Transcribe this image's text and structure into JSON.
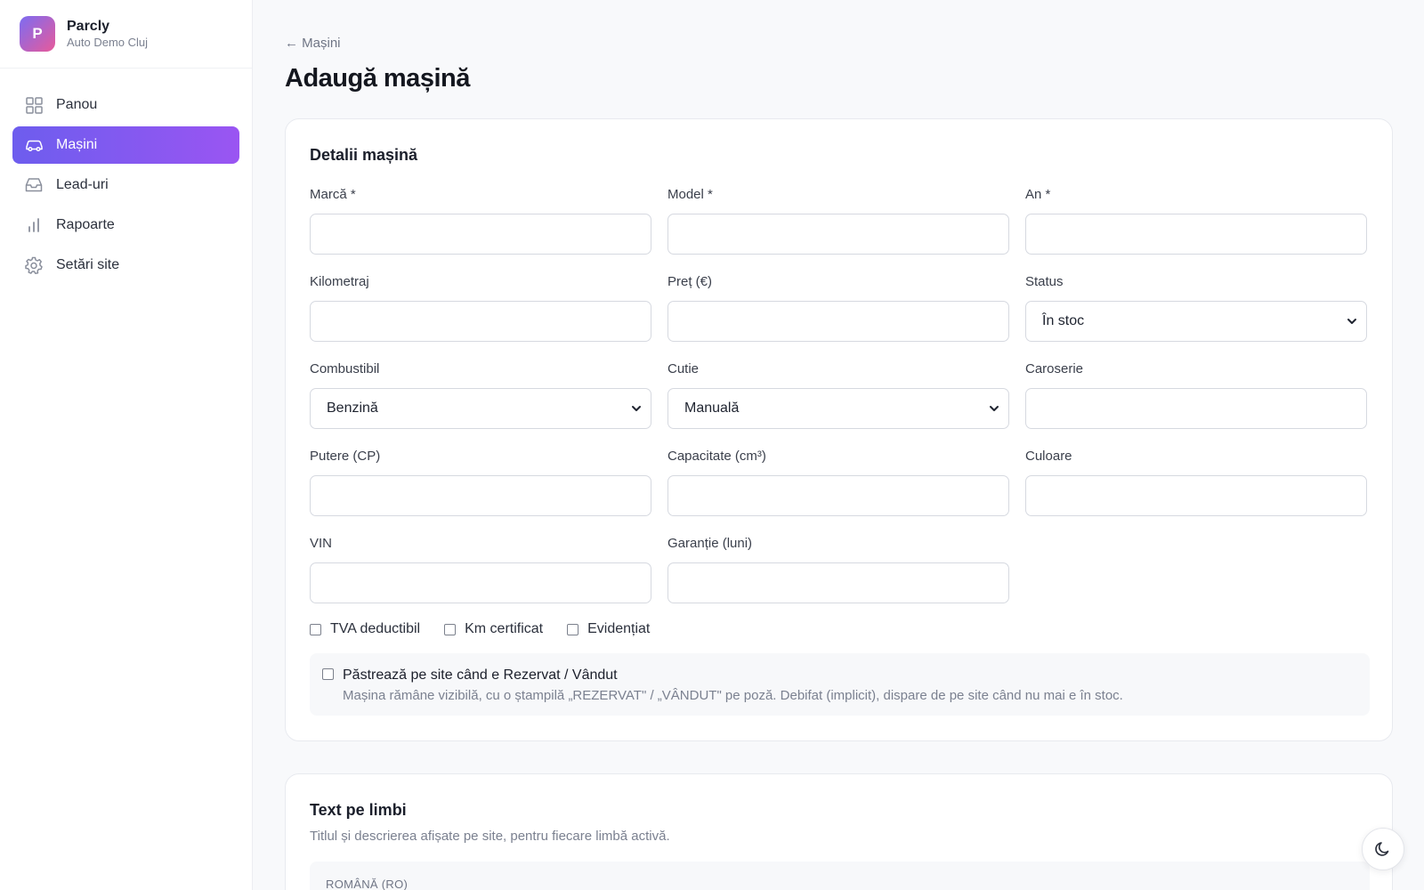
{
  "brand": {
    "initial": "P",
    "name": "Parcly",
    "subtitle": "Auto Demo Cluj"
  },
  "nav": [
    {
      "label": "Panou",
      "icon": "grid-icon",
      "active": false
    },
    {
      "label": "Mașini",
      "icon": "car-icon",
      "active": true
    },
    {
      "label": "Lead-uri",
      "icon": "inbox-icon",
      "active": false
    },
    {
      "label": "Rapoarte",
      "icon": "bar-chart-icon",
      "active": false
    },
    {
      "label": "Setări site",
      "icon": "gear-icon",
      "active": false
    }
  ],
  "header": {
    "back_label": "← Mașini",
    "title": "Adaugă mașină"
  },
  "details": {
    "title": "Detalii mașină",
    "fields": {
      "make": {
        "label": "Marcă *",
        "value": ""
      },
      "model": {
        "label": "Model *",
        "value": ""
      },
      "year": {
        "label": "An *",
        "value": ""
      },
      "mileage": {
        "label": "Kilometraj",
        "value": ""
      },
      "price": {
        "label": "Preț (€)",
        "value": ""
      },
      "status": {
        "label": "Status",
        "value": "În stoc"
      },
      "fuel": {
        "label": "Combustibil",
        "value": "Benzină"
      },
      "gearbox": {
        "label": "Cutie",
        "value": "Manuală"
      },
      "body": {
        "label": "Caroserie",
        "value": ""
      },
      "power": {
        "label": "Putere (CP)",
        "value": ""
      },
      "capacity": {
        "label": "Capacitate (cm³)",
        "value": ""
      },
      "color": {
        "label": "Culoare",
        "value": ""
      },
      "vin": {
        "label": "VIN",
        "value": ""
      },
      "warranty": {
        "label": "Garanție (luni)",
        "value": ""
      }
    },
    "checkboxes": [
      {
        "label": "TVA deductibil",
        "checked": false
      },
      {
        "label": "Km certificat",
        "checked": false
      },
      {
        "label": "Evidențiat",
        "checked": false
      }
    ],
    "keep_on_site": {
      "label": "Păstrează pe site când e Rezervat / Vândut",
      "description": "Mașina rămâne vizibilă, cu o ștampilă „REZERVAT\" / „VÂNDUT\" pe poză. Debifat (implicit), dispare de pe site când nu mai e în stoc.",
      "checked": false
    }
  },
  "languages": {
    "title": "Text pe limbi",
    "subtitle": "Titlul și descrierea afișate pe site, pentru fiecare limbă activă.",
    "first_language": "ROMÂNĂ (RO)"
  },
  "colors": {
    "accent_start": "#6d5dee",
    "accent_end": "#9a55f2"
  }
}
